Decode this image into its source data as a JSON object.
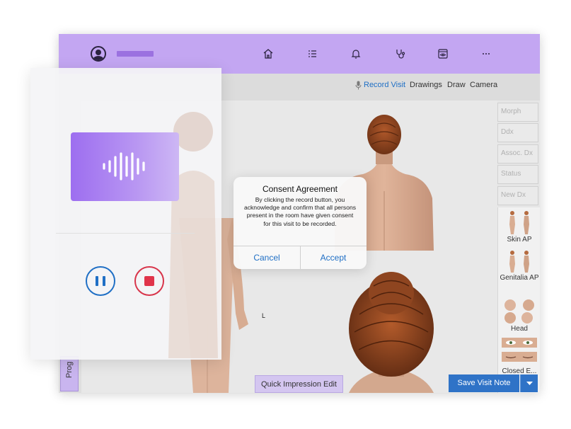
{
  "toolbar": {
    "record_visit": "Record Visit",
    "drawings": "Drawings",
    "draw": "Draw",
    "camera": "Camera"
  },
  "nav_icons": [
    "home-icon",
    "list-icon",
    "bell-icon",
    "stethoscope-icon",
    "eye-icon",
    "more-icon"
  ],
  "side_panel": {
    "buttons": [
      "Morph",
      "Ddx",
      "Assoc. Dx",
      "Status",
      "New Dx"
    ],
    "thumbnails": [
      "Skin AP",
      "Genitalia AP",
      "Head",
      "Closed E..."
    ]
  },
  "left_tab": "Prog",
  "marker_label": "L",
  "bottom": {
    "quick_impression": "Quick Impression Edit",
    "save_visit": "Save Visit Note"
  },
  "dialog": {
    "title": "Consent Agreement",
    "body": "By clicking the record button, you acknowledge and confirm that all persons present in the room have given consent for this visit to be recorded.",
    "cancel": "Cancel",
    "accept": "Accept"
  },
  "colors": {
    "topbar": "#c3a6f2",
    "accent_blue": "#1f6fc5",
    "record_red": "#d8344a",
    "wave_gradient_start": "#9d6ef0"
  }
}
